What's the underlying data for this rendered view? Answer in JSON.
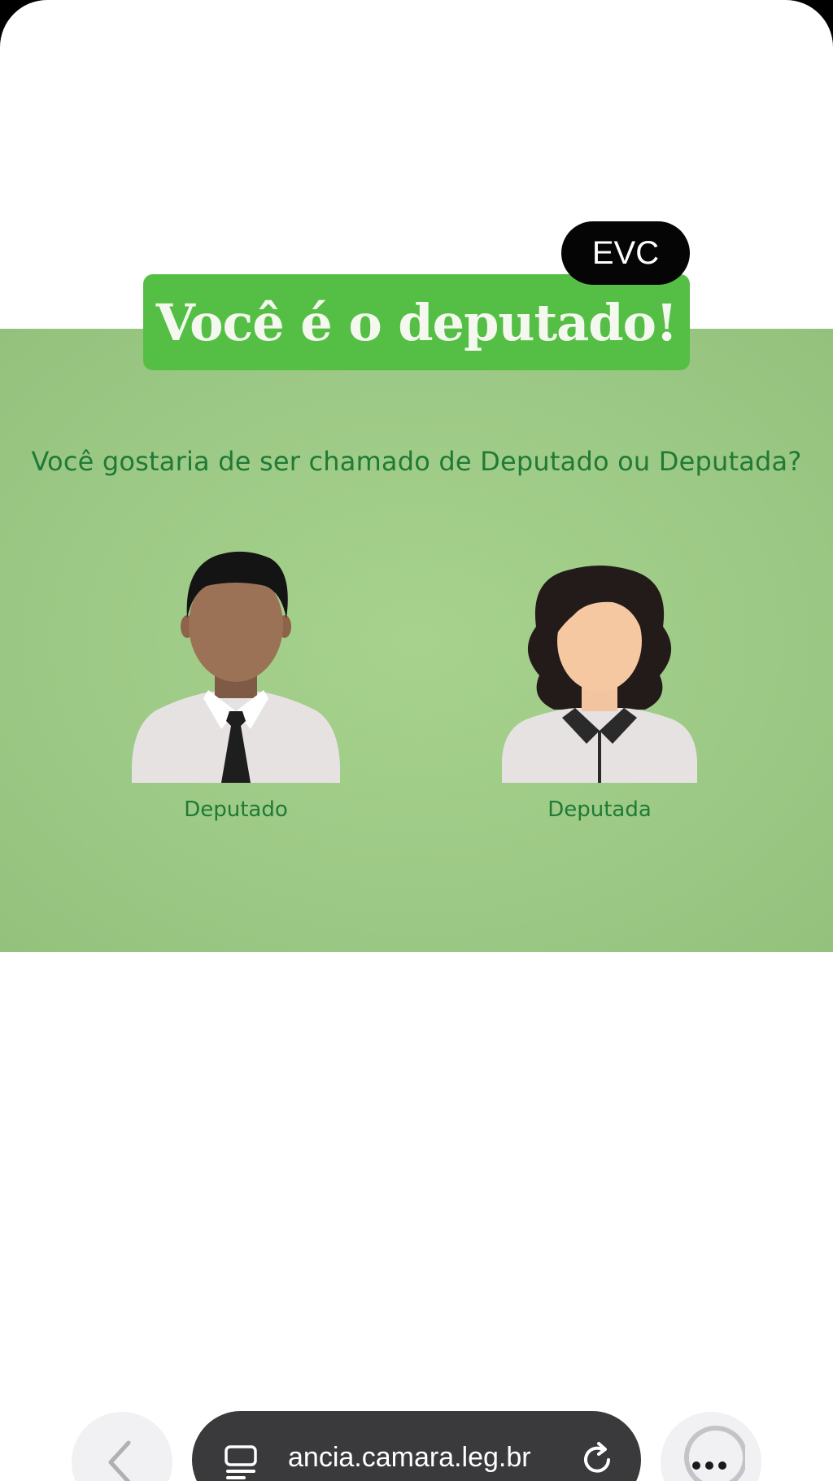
{
  "banner": {
    "title": "Você é o deputado!",
    "badge": "EVC",
    "background_color": "#55bf45"
  },
  "content": {
    "background_color": "#9cc985",
    "question": "Você gostaria de ser chamado de Deputado ou Deputada?",
    "options": [
      {
        "label": "Deputado",
        "icon": "male-avatar-icon"
      },
      {
        "label": "Deputada",
        "icon": "female-avatar-icon"
      }
    ]
  },
  "browser": {
    "url": "ancia.camara.leg.br",
    "back_icon": "chevron-left-icon",
    "tabs_icon": "tabs-icon",
    "reload_icon": "reload-icon",
    "more_icon": "more-dots-icon"
  }
}
